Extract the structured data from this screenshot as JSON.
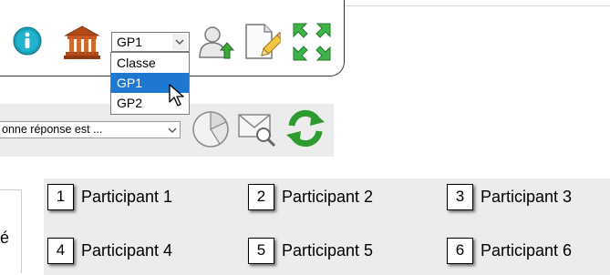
{
  "toolbar": {
    "info_icon": "info-icon",
    "bank_icon": "bank-icon",
    "group_select": {
      "value": "GP1",
      "options": [
        "Classe",
        "GP1",
        "GP2"
      ],
      "highlighted_option": "GP1"
    },
    "user_up_icon": "user-upload-icon",
    "doc_edit_icon": "document-edit-icon",
    "fullscreen_icon": "fullscreen-icon"
  },
  "question_bar": {
    "answer_select_value": "onne réponse est ...",
    "pie_icon": "pie-chart-icon",
    "mail_icon": "mail-search-icon",
    "refresh_icon": "refresh-icon"
  },
  "left_edge_text": "é",
  "participants": [
    {
      "num": "1",
      "name": "Participant 1"
    },
    {
      "num": "2",
      "name": "Participant 2"
    },
    {
      "num": "3",
      "name": "Participant 3"
    },
    {
      "num": "4",
      "name": "Participant 4"
    },
    {
      "num": "5",
      "name": "Participant 5"
    },
    {
      "num": "6",
      "name": "Participant 6"
    }
  ],
  "colors": {
    "selection_blue": "#1e78d2",
    "info_teal": "#1a9fb8",
    "refresh_green": "#2e9b2e",
    "panel_gray": "#ececec"
  }
}
